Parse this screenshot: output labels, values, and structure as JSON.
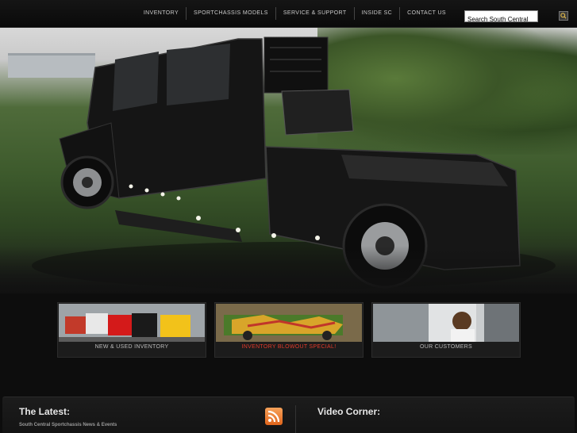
{
  "nav": {
    "items": [
      {
        "label": "INVENTORY"
      },
      {
        "label": "SPORTCHASSIS MODELS"
      },
      {
        "label": "SERVICE & SUPPORT"
      },
      {
        "label": "INSIDE SC"
      },
      {
        "label": "CONTACT US"
      }
    ]
  },
  "search": {
    "value": "Search South Central",
    "icon": "search-icon"
  },
  "cards": [
    {
      "label": "NEW & USED INVENTORY",
      "color": "#bbbbbb"
    },
    {
      "label": "INVENTORY BLOWOUT SPECIAL!",
      "color": "#e23a2a"
    },
    {
      "label": "OUR CUSTOMERS",
      "color": "#bbbbbb"
    }
  ],
  "latest": {
    "title": "The Latest:",
    "subtitle": "South Central Sportchassis News & Events",
    "icon": "rss-icon"
  },
  "video": {
    "title": "Video Corner:"
  },
  "colors": {
    "background": "#0d0d0d",
    "highlight_red": "#e23a2a",
    "rss_orange": "#f08a3c"
  }
}
